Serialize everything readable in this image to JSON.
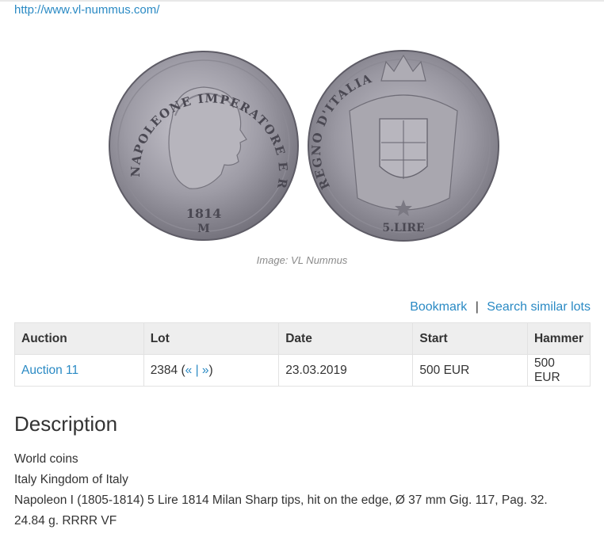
{
  "header": {
    "site_url": "http://www.vl-nummus.com/"
  },
  "image": {
    "caption": "Image: VL Nummus",
    "obverse": {
      "legend": "NAPOLEONE IMPERATORE E RE",
      "year": "1814",
      "mint": "M"
    },
    "reverse": {
      "legend": "REGNO D'ITALIA",
      "denomination": "5.LIRE"
    }
  },
  "actions": {
    "bookmark": "Bookmark",
    "separator": "|",
    "search_similar": "Search similar lots"
  },
  "table": {
    "headers": [
      "Auction",
      "Lot",
      "Date",
      "Start",
      "Hammer"
    ],
    "row": {
      "auction": "Auction 11",
      "lot_number": "2384",
      "lot_open": " (",
      "prev": "«",
      "lot_sep": " | ",
      "next": "»",
      "lot_close": ")",
      "date": "23.03.2019",
      "start": "500 EUR",
      "hammer": "500 EUR"
    }
  },
  "description": {
    "title": "Description",
    "lines": [
      "World coins",
      "Italy Kingdom of Italy",
      "Napoleon I (1805-1814) 5 Lire 1814 Milan Sharp tips, hit on the edge, Ø 37 mm Gig. 117, Pag. 32.",
      "24.84 g. RRRR VF"
    ]
  }
}
